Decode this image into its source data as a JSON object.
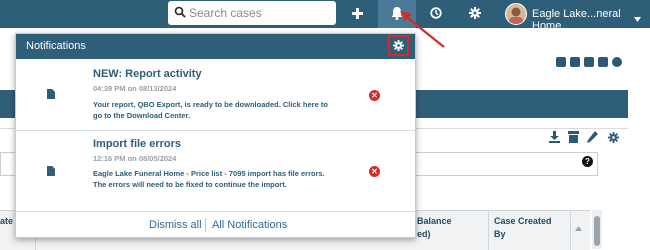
{
  "topbar": {
    "search": {
      "placeholder": "Search cases"
    },
    "user_name": "Eagle Lake...neral Home",
    "icons": [
      "search-icon",
      "plus-icon",
      "bell-icon",
      "clock-icon",
      "gear-icon",
      "chevron-down-icon"
    ]
  },
  "notifications": {
    "title": "Notifications",
    "items": [
      {
        "title": "NEW: Report activity",
        "time": "04:39 PM on 08/13/2024",
        "body": "Your report, QBO Export, is ready to be downloaded. Click here to go to the Download Center."
      },
      {
        "title": "Import file errors",
        "time": "12:16 PM on 08/05/2024",
        "body": "Eagle Lake Funeral Home - Price list - 7095 import has file errors. The errors will need to be fixed to continue the import."
      }
    ],
    "dismiss_all": "Dismiss all",
    "all_notifications": "All Notifications"
  },
  "table": {
    "headers": [
      {
        "text": "ate o"
      },
      {
        "text": "Balance"
      },
      {
        "text": "ed)"
      },
      {
        "text": "Case Created"
      },
      {
        "text": "By"
      }
    ]
  },
  "colors": {
    "header_blue": "#2f5e79",
    "accent_red": "#d42a2a",
    "link_blue": "#2f6a92"
  }
}
